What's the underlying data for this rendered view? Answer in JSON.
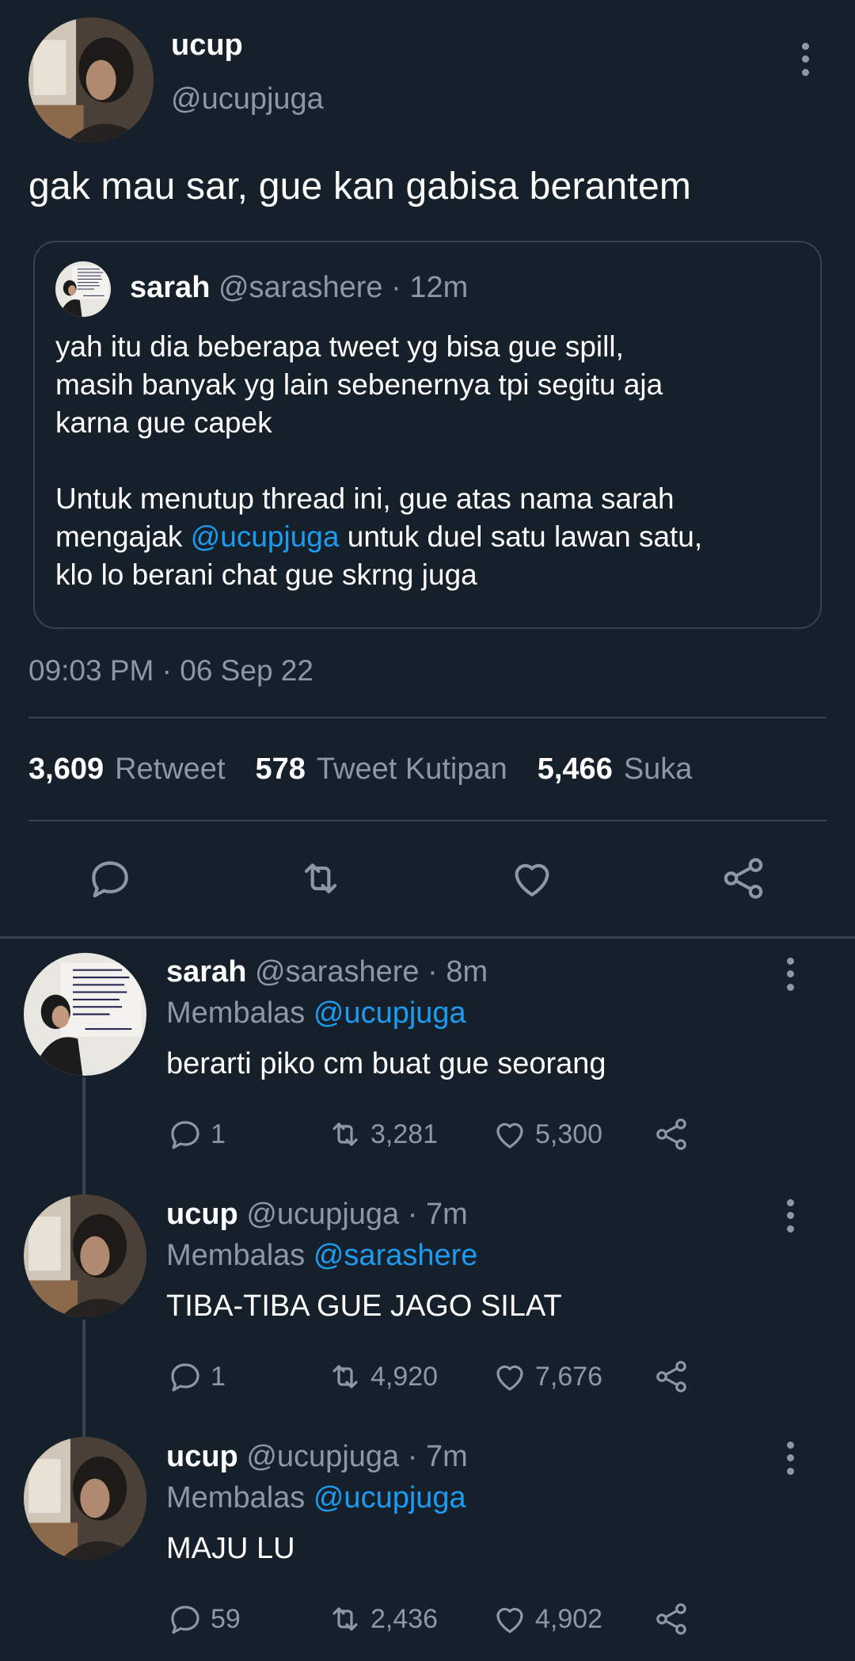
{
  "main_tweet": {
    "name": "ucup",
    "handle": "@ucupjuga",
    "text": "gak mau sar, gue kan gabisa berantem",
    "quote": {
      "name": "sarah",
      "handle": "@sarashere",
      "time": "12m",
      "paragraph1": "yah itu dia beberapa tweet yg bisa gue spill,\nmasih banyak yg lain sebenernya tpi segitu aja\nkarna gue capek",
      "paragraph2_before": "Untuk menutup thread ini, gue atas nama sarah\nmengajak ",
      "paragraph2_mention": "@ucupjuga",
      "paragraph2_after": " untuk duel satu lawan satu,\nklo lo berani chat gue skrng juga"
    },
    "timestamp": "09:03 PM · 06 Sep 22",
    "stats": {
      "retweets": "3,609",
      "retweets_label": "Retweet",
      "quotes": "578",
      "quotes_label": "Tweet Kutipan",
      "likes": "5,466",
      "likes_label": "Suka"
    }
  },
  "replies": [
    {
      "name": "sarah",
      "handle": "@sarashere",
      "time": "8m",
      "replying_label": "Membalas",
      "replying_to": "@ucupjuga",
      "text": "berarti piko cm buat gue seorang",
      "replies": "1",
      "retweets": "3,281",
      "likes": "5,300"
    },
    {
      "name": "ucup",
      "handle": "@ucupjuga",
      "time": "7m",
      "replying_label": "Membalas",
      "replying_to": "@sarashere",
      "text": "TIBA-TIBA GUE JAGO SILAT",
      "replies": "1",
      "retweets": "4,920",
      "likes": "7,676"
    },
    {
      "name": "ucup",
      "handle": "@ucupjuga",
      "time": "7m",
      "replying_label": "Membalas",
      "replying_to": "@ucupjuga",
      "text": "MAJU LU",
      "replies": "59",
      "retweets": "2,436",
      "likes": "4,902"
    }
  ],
  "colors": {
    "background": "#15202b",
    "accent": "#1d9bf0",
    "muted": "#8b98a5",
    "border": "#38444d"
  },
  "icons": [
    "more-vertical-icon",
    "reply-icon",
    "retweet-icon",
    "like-icon",
    "share-icon"
  ]
}
